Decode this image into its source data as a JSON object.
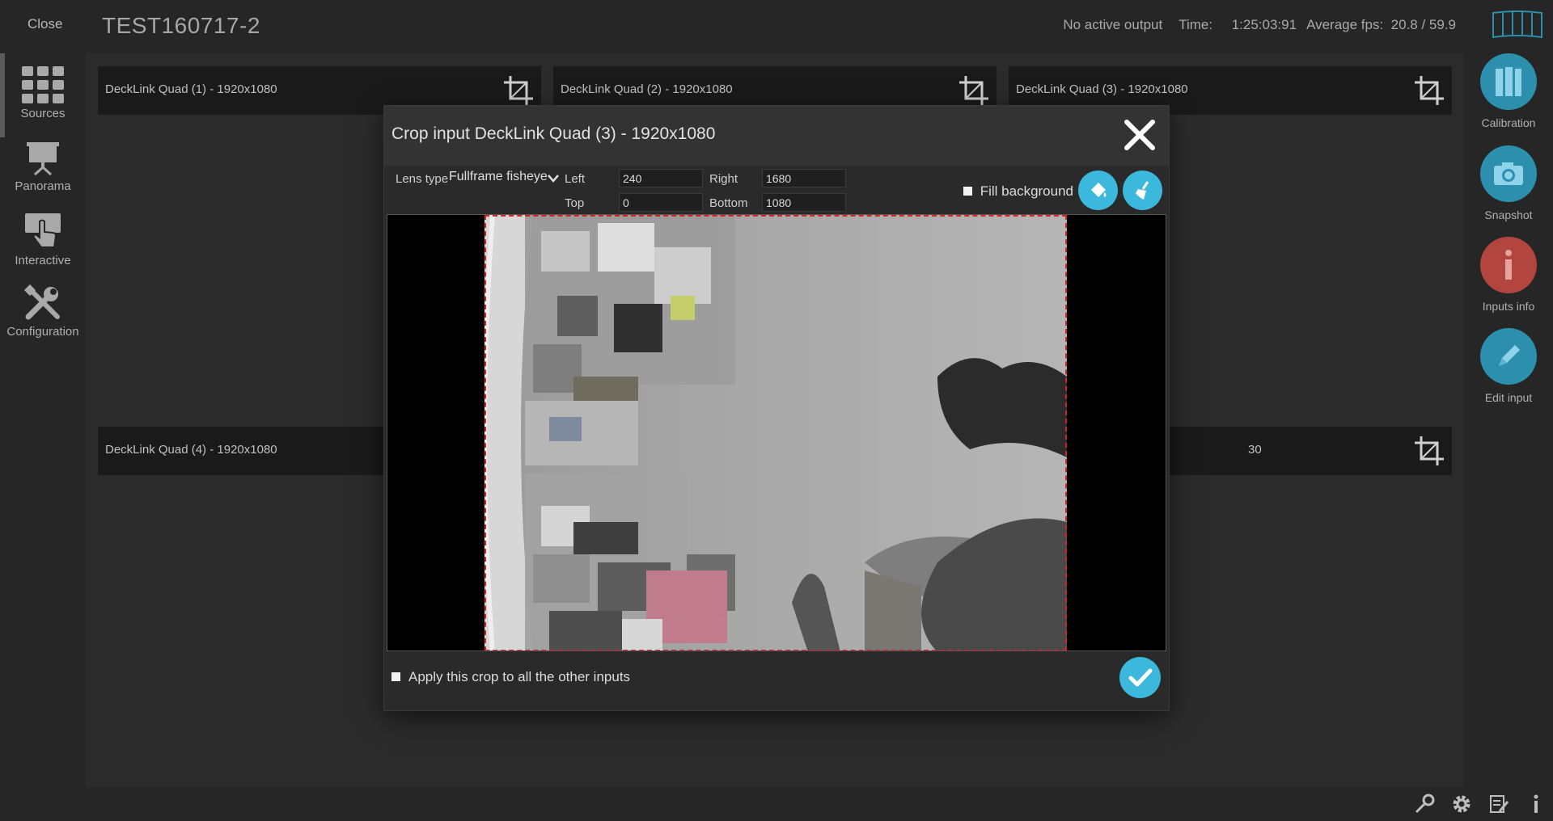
{
  "topbar": {
    "close_label": "Close",
    "project_title": "TEST160717-2",
    "output_status": "No active output",
    "time_label": "Time:",
    "time_value": "1:25:03:91",
    "fps_label": "Average fps:",
    "fps_value": "20.8 / 59.9"
  },
  "left_nav": {
    "items": [
      {
        "label": "Sources",
        "icon": "grid-icon",
        "active": true
      },
      {
        "label": "Panorama",
        "icon": "presentation-icon"
      },
      {
        "label": "Interactive",
        "icon": "hand-pointer-icon"
      },
      {
        "label": "Configuration",
        "icon": "tools-icon"
      }
    ]
  },
  "sources": [
    {
      "label": "DeckLink Quad (1) - 1920x1080"
    },
    {
      "label": "DeckLink Quad (2) - 1920x1080"
    },
    {
      "label": "DeckLink Quad (3) - 1920x1080"
    },
    {
      "label": "DeckLink Quad (4) - 1920x1080"
    },
    {
      "label": "30"
    }
  ],
  "right_nav": {
    "items": [
      {
        "label": "Calibration",
        "icon": "calibration-icon",
        "color": "#2c8fae"
      },
      {
        "label": "Snapshot",
        "icon": "camera-icon",
        "color": "#2c8fae"
      },
      {
        "label": "Inputs info",
        "icon": "info-icon",
        "color": "#b2463e"
      },
      {
        "label": "Edit input",
        "icon": "pencil-icon",
        "color": "#2c8fae"
      }
    ]
  },
  "modal": {
    "title": "Crop input DeckLink Quad (3) - 1920x1080",
    "lens_type_label": "Lens type",
    "lens_type_value": "Fullframe fisheye",
    "left_label": "Left",
    "left_value": "240",
    "right_label": "Right",
    "right_value": "1680",
    "top_label": "Top",
    "top_value": "0",
    "bottom_label": "Bottom",
    "bottom_value": "1080",
    "fill_background_label": "Fill background",
    "apply_all_label": "Apply this crop to all the other inputs"
  },
  "colors": {
    "accent": "#3bb8dc",
    "crop_border": "#e02020",
    "info_red": "#b2463e"
  }
}
